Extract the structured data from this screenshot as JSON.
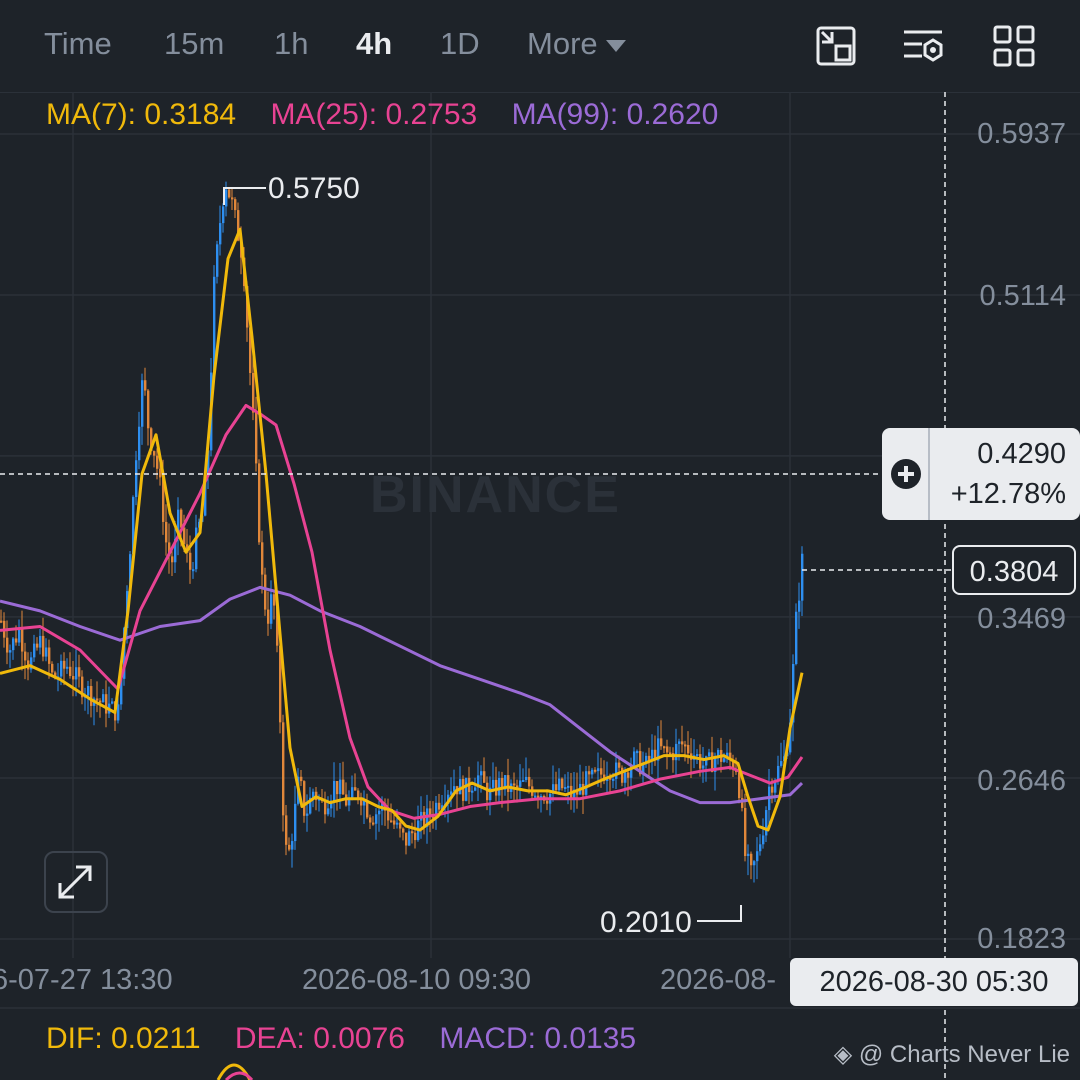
{
  "toolbar": {
    "timeframes": [
      "Time",
      "15m",
      "1h",
      "4h",
      "1D",
      "More"
    ],
    "active": "4h",
    "icons": [
      "fullscreen-exit-icon",
      "indicator-settings-icon",
      "layout-grid-icon"
    ]
  },
  "ma_legend": {
    "ma7": "MA(7): 0.3184",
    "ma25": "MA(25): 0.2753",
    "ma99": "MA(99): 0.2620"
  },
  "price_axis": [
    "0.5937",
    "0.5114",
    "0.3469",
    "0.2646",
    "0.1823"
  ],
  "time_axis": [
    "6-07-27 13:30",
    "2026-08-10 09:30",
    "2026-08-"
  ],
  "current_price": "0.3804",
  "crosshair": {
    "price": "0.4290",
    "change": "+12.78%",
    "time": "2026-08-30 05:30"
  },
  "annotations": {
    "high": "0.5750",
    "low": "0.2010"
  },
  "macd_legend": {
    "dif": "DIF: 0.0211",
    "dea": "DEA: 0.0076",
    "macd": "MACD: 0.0135"
  },
  "watermark": "BINANCE",
  "credit": "@ Charts Never Lie",
  "colors": {
    "background": "#1e2329",
    "grid": "#2b3139",
    "up": "#2e8ff0",
    "down": "#e0873a",
    "ma7": "#f0b90b",
    "ma25": "#e84393",
    "ma99": "#9b6bd6",
    "text": "#848e9c",
    "highlight": "#eaecef"
  },
  "chart_data": {
    "type": "line",
    "title": "",
    "ylim": [
      0.1823,
      0.5937
    ],
    "y_ticks": [
      0.5937,
      0.5114,
      0.4292,
      0.3469,
      0.2646,
      0.1823
    ],
    "grid": true,
    "close_points": [
      [
        0,
        0.345
      ],
      [
        8,
        0.33
      ],
      [
        18,
        0.34
      ],
      [
        28,
        0.322
      ],
      [
        40,
        0.335
      ],
      [
        52,
        0.315
      ],
      [
        66,
        0.322
      ],
      [
        80,
        0.312
      ],
      [
        95,
        0.305
      ],
      [
        110,
        0.3
      ],
      [
        118,
        0.298
      ],
      [
        124,
        0.35
      ],
      [
        130,
        0.39
      ],
      [
        136,
        0.44
      ],
      [
        142,
        0.47
      ],
      [
        148,
        0.44
      ],
      [
        154,
        0.43
      ],
      [
        160,
        0.41
      ],
      [
        166,
        0.38
      ],
      [
        172,
        0.375
      ],
      [
        178,
        0.4
      ],
      [
        184,
        0.38
      ],
      [
        190,
        0.37
      ],
      [
        196,
        0.39
      ],
      [
        202,
        0.4
      ],
      [
        208,
        0.44
      ],
      [
        212,
        0.51
      ],
      [
        218,
        0.545
      ],
      [
        224,
        0.57
      ],
      [
        230,
        0.56
      ],
      [
        236,
        0.545
      ],
      [
        242,
        0.53
      ],
      [
        248,
        0.48
      ],
      [
        254,
        0.43
      ],
      [
        260,
        0.37
      ],
      [
        266,
        0.345
      ],
      [
        272,
        0.36
      ],
      [
        278,
        0.31
      ],
      [
        282,
        0.25
      ],
      [
        286,
        0.22
      ],
      [
        292,
        0.24
      ],
      [
        298,
        0.265
      ],
      [
        304,
        0.245
      ],
      [
        312,
        0.258
      ],
      [
        322,
        0.25
      ],
      [
        334,
        0.262
      ],
      [
        346,
        0.252
      ],
      [
        358,
        0.258
      ],
      [
        370,
        0.245
      ],
      [
        382,
        0.25
      ],
      [
        394,
        0.24
      ],
      [
        404,
        0.232
      ],
      [
        416,
        0.24
      ],
      [
        428,
        0.245
      ],
      [
        440,
        0.255
      ],
      [
        452,
        0.262
      ],
      [
        464,
        0.258
      ],
      [
        476,
        0.266
      ],
      [
        488,
        0.256
      ],
      [
        500,
        0.262
      ],
      [
        512,
        0.258
      ],
      [
        524,
        0.262
      ],
      [
        536,
        0.258
      ],
      [
        548,
        0.256
      ],
      [
        560,
        0.26
      ],
      [
        572,
        0.255
      ],
      [
        584,
        0.262
      ],
      [
        596,
        0.265
      ],
      [
        608,
        0.27
      ],
      [
        620,
        0.266
      ],
      [
        632,
        0.274
      ],
      [
        644,
        0.27
      ],
      [
        656,
        0.28
      ],
      [
        668,
        0.276
      ],
      [
        680,
        0.282
      ],
      [
        692,
        0.278
      ],
      [
        704,
        0.27
      ],
      [
        716,
        0.276
      ],
      [
        728,
        0.274
      ],
      [
        736,
        0.27
      ],
      [
        740,
        0.25
      ],
      [
        744,
        0.225
      ],
      [
        750,
        0.215
      ],
      [
        756,
        0.225
      ],
      [
        762,
        0.24
      ],
      [
        768,
        0.26
      ],
      [
        776,
        0.268
      ],
      [
        784,
        0.275
      ],
      [
        790,
        0.3
      ],
      [
        794,
        0.34
      ],
      [
        798,
        0.36
      ],
      [
        802,
        0.3804
      ]
    ],
    "ma7_points": [
      [
        0,
        0.318
      ],
      [
        30,
        0.322
      ],
      [
        60,
        0.315
      ],
      [
        90,
        0.305
      ],
      [
        115,
        0.298
      ],
      [
        128,
        0.35
      ],
      [
        142,
        0.42
      ],
      [
        156,
        0.44
      ],
      [
        170,
        0.4
      ],
      [
        186,
        0.38
      ],
      [
        200,
        0.39
      ],
      [
        214,
        0.47
      ],
      [
        228,
        0.53
      ],
      [
        240,
        0.545
      ],
      [
        252,
        0.49
      ],
      [
        266,
        0.42
      ],
      [
        278,
        0.35
      ],
      [
        290,
        0.28
      ],
      [
        302,
        0.25
      ],
      [
        316,
        0.255
      ],
      [
        330,
        0.252
      ],
      [
        346,
        0.254
      ],
      [
        362,
        0.254
      ],
      [
        378,
        0.25
      ],
      [
        392,
        0.248
      ],
      [
        406,
        0.24
      ],
      [
        420,
        0.238
      ],
      [
        438,
        0.245
      ],
      [
        456,
        0.258
      ],
      [
        472,
        0.262
      ],
      [
        490,
        0.258
      ],
      [
        508,
        0.26
      ],
      [
        528,
        0.258
      ],
      [
        548,
        0.258
      ],
      [
        566,
        0.256
      ],
      [
        586,
        0.26
      ],
      [
        604,
        0.264
      ],
      [
        624,
        0.268
      ],
      [
        644,
        0.272
      ],
      [
        664,
        0.276
      ],
      [
        684,
        0.276
      ],
      [
        704,
        0.274
      ],
      [
        724,
        0.276
      ],
      [
        738,
        0.272
      ],
      [
        748,
        0.255
      ],
      [
        758,
        0.24
      ],
      [
        768,
        0.238
      ],
      [
        780,
        0.255
      ],
      [
        790,
        0.29
      ],
      [
        802,
        0.3184
      ]
    ],
    "ma25_points": [
      [
        0,
        0.34
      ],
      [
        40,
        0.342
      ],
      [
        80,
        0.33
      ],
      [
        118,
        0.31
      ],
      [
        140,
        0.35
      ],
      [
        170,
        0.38
      ],
      [
        200,
        0.41
      ],
      [
        226,
        0.44
      ],
      [
        246,
        0.455
      ],
      [
        262,
        0.45
      ],
      [
        276,
        0.445
      ],
      [
        294,
        0.415
      ],
      [
        312,
        0.38
      ],
      [
        330,
        0.33
      ],
      [
        350,
        0.285
      ],
      [
        368,
        0.26
      ],
      [
        390,
        0.248
      ],
      [
        414,
        0.244
      ],
      [
        440,
        0.246
      ],
      [
        470,
        0.25
      ],
      [
        500,
        0.252
      ],
      [
        540,
        0.254
      ],
      [
        580,
        0.254
      ],
      [
        620,
        0.258
      ],
      [
        660,
        0.264
      ],
      [
        700,
        0.268
      ],
      [
        730,
        0.27
      ],
      [
        750,
        0.266
      ],
      [
        770,
        0.262
      ],
      [
        788,
        0.265
      ],
      [
        802,
        0.2753
      ]
    ],
    "ma99_points": [
      [
        0,
        0.355
      ],
      [
        40,
        0.35
      ],
      [
        80,
        0.342
      ],
      [
        120,
        0.335
      ],
      [
        160,
        0.342
      ],
      [
        200,
        0.345
      ],
      [
        230,
        0.356
      ],
      [
        260,
        0.362
      ],
      [
        290,
        0.358
      ],
      [
        320,
        0.35
      ],
      [
        360,
        0.342
      ],
      [
        400,
        0.332
      ],
      [
        440,
        0.322
      ],
      [
        480,
        0.315
      ],
      [
        520,
        0.308
      ],
      [
        550,
        0.302
      ],
      [
        580,
        0.29
      ],
      [
        610,
        0.278
      ],
      [
        640,
        0.268
      ],
      [
        670,
        0.258
      ],
      [
        700,
        0.252
      ],
      [
        730,
        0.252
      ],
      [
        760,
        0.254
      ],
      [
        790,
        0.256
      ],
      [
        802,
        0.262
      ]
    ],
    "series": [
      {
        "name": "MA(7)",
        "last": 0.3184
      },
      {
        "name": "MA(25)",
        "last": 0.2753
      },
      {
        "name": "MA(99)",
        "last": 0.262
      }
    ]
  }
}
